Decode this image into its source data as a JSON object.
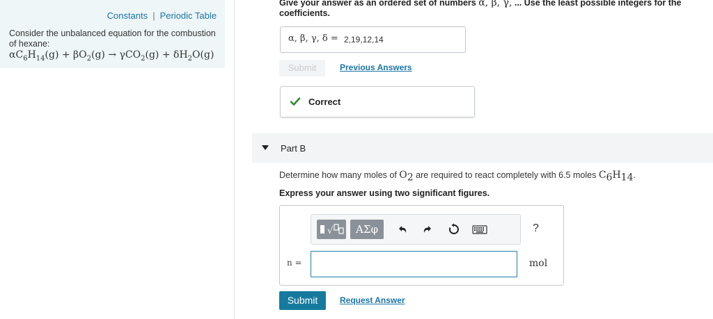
{
  "left_panel": {
    "links": [
      "Constants",
      "Periodic Table"
    ],
    "problem_text": "Consider the unbalanced equation for the combustion of hexane:",
    "equation": {
      "a": "α",
      "reactant1": "C",
      "r1_sub1": "6",
      "r1_mid": "H",
      "r1_sub2": "14",
      "state1": "(g) + ",
      "b": "β",
      "reactant2": "O",
      "r2_sub": "2",
      "state2": "(g) → ",
      "g": "γ",
      "product1": "CO",
      "p1_sub": "2",
      "state3": "(g) + ",
      "d": "δ",
      "product2": "H",
      "p2_sub": "2",
      "product2b": "O",
      "state4": "(g)"
    }
  },
  "part_a": {
    "instruction_prefix": "Give your answer as an ordered set of numbers ",
    "instruction_symbols": "α, β, γ,",
    "instruction_suffix": " ... Use the least possible integers for the coefficients.",
    "answer_label": "α, β, γ, δ =",
    "answer_value": "2,19,12,14",
    "submit_label": "Submit",
    "previous_answers_label": "Previous Answers",
    "feedback_text": "Correct"
  },
  "part_b": {
    "title": "Part B",
    "question_prefix": "Determine how many moles of ",
    "q_species": "O",
    "q_sub": "2",
    "question_mid": " are required to react completely with 6.5 moles ",
    "q_species2": "C",
    "q_sub2a": "6",
    "q_species2b": "H",
    "q_sub2b": "14",
    "question_end": ".",
    "express": "Express your answer using two significant figures.",
    "toolbar": {
      "greek_label": "ΑΣφ",
      "help_label": "?"
    },
    "var_label": "n =",
    "input_value": "",
    "unit": "mol",
    "submit_label": "Submit",
    "request_answer_label": "Request Answer"
  },
  "colors": {
    "link": "#1b74a8",
    "primary": "#167a9e",
    "check": "#2e8b2e",
    "input_border": "#1e7ea8"
  }
}
